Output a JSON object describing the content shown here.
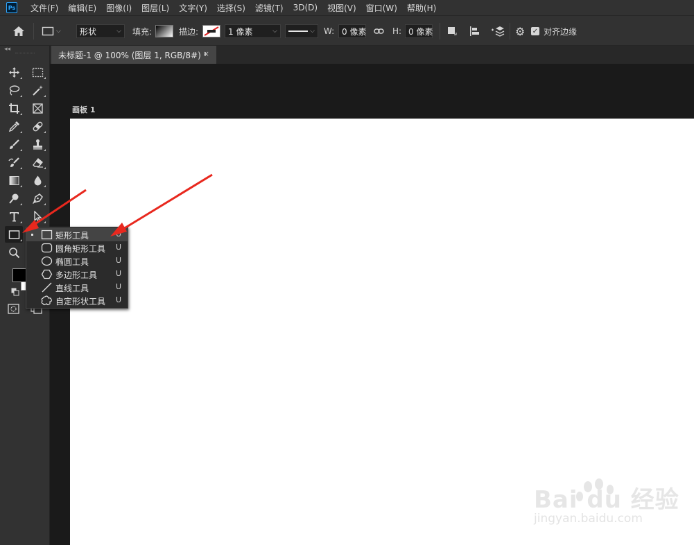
{
  "app": {
    "logo": "Ps"
  },
  "menubar": {
    "items": [
      "文件(F)",
      "编辑(E)",
      "图像(I)",
      "图层(L)",
      "文字(Y)",
      "选择(S)",
      "滤镜(T)",
      "3D(D)",
      "视图(V)",
      "窗口(W)",
      "帮助(H)"
    ]
  },
  "options": {
    "mode_value": "形状",
    "fill_label": "填充:",
    "stroke_label": "描边:",
    "stroke_width_value": "1 像素",
    "w_label": "W:",
    "w_value": "0 像素",
    "h_label": "H:",
    "h_value": "0 像素",
    "align_edges_label": "对齐边缘",
    "align_edges_checked": true
  },
  "document": {
    "tab_title": "未标题-1 @ 100% (图层 1, RGB/8#) *",
    "close_glyph": "×",
    "artboard_label": "画板 1"
  },
  "toolbar": {
    "collapse_glyph": "◂◂",
    "foreground_color": "#000000",
    "background_color": "#ffffff"
  },
  "flyout": {
    "items": [
      {
        "label": "矩形工具",
        "shortcut": "U",
        "icon": "rectangle-icon",
        "selected": true
      },
      {
        "label": "圆角矩形工具",
        "shortcut": "U",
        "icon": "rounded-rectangle-icon",
        "selected": false
      },
      {
        "label": "椭圆工具",
        "shortcut": "U",
        "icon": "ellipse-icon",
        "selected": false
      },
      {
        "label": "多边形工具",
        "shortcut": "U",
        "icon": "polygon-icon",
        "selected": false
      },
      {
        "label": "直线工具",
        "shortcut": "U",
        "icon": "line-icon",
        "selected": false
      },
      {
        "label": "自定形状工具",
        "shortcut": "U",
        "icon": "custom-shape-icon",
        "selected": false
      }
    ]
  },
  "annotations": {
    "arrow_color": "#e8281e"
  },
  "watermark": {
    "brand": "Bai du 经验",
    "url": "jingyan.baidu.com"
  }
}
